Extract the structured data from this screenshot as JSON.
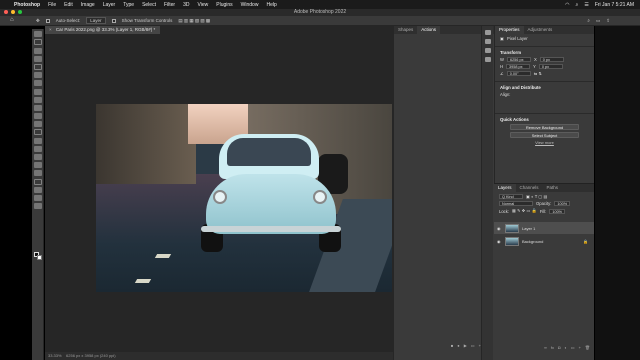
{
  "menubar": {
    "apple": "",
    "items": [
      "Photoshop",
      "File",
      "Edit",
      "Image",
      "Layer",
      "Type",
      "Select",
      "Filter",
      "3D",
      "View",
      "Plugins",
      "Window",
      "Help"
    ],
    "datetime": "Fri Jan 7  5:21 AM"
  },
  "window": {
    "title": "Adobe Photoshop 2022"
  },
  "options": {
    "auto_select_label": "Auto-Select:",
    "auto_select_value": "Layer",
    "transform_label": "Show Transform Controls"
  },
  "document": {
    "tab_title": "Car Paris 2022.png @ 33.3% (Layer 1, RGB/8#) *",
    "status_zoom": "33.33%",
    "status_info": "6256 px x 3958 px (240 ppi)"
  },
  "midpanel": {
    "tabs": [
      "Shapes",
      "Actions"
    ]
  },
  "properties": {
    "tabs": [
      "Properties",
      "Adjustments"
    ],
    "kind": "Pixel Layer",
    "transform": {
      "title": "Transform",
      "w_label": "W",
      "w_value": "6256 px",
      "x_label": "X",
      "x_value": "0 px",
      "h_label": "H",
      "h_value": "3958 px",
      "y_label": "Y",
      "y_value": "0 px",
      "angle": "0.00°"
    },
    "align": {
      "title": "Align and Distribute",
      "sub": "Align:"
    },
    "quick": {
      "title": "Quick Actions",
      "remove_bg": "Remove Background",
      "select_subject": "Select Subject",
      "view_more": "View more"
    }
  },
  "layers": {
    "tabs": [
      "Layers",
      "Channels",
      "Paths"
    ],
    "filter": "Q Kind",
    "blend_mode": "Normal",
    "opacity_label": "Opacity:",
    "opacity_value": "100%",
    "lock_label": "Lock:",
    "fill_label": "Fill:",
    "fill_value": "100%",
    "items": [
      {
        "name": "Layer 1"
      },
      {
        "name": "Background"
      }
    ]
  },
  "colors": {
    "accent": "#2d8ceb",
    "panel_bg": "#3a3a3a",
    "canvas_bg": "#262626"
  }
}
